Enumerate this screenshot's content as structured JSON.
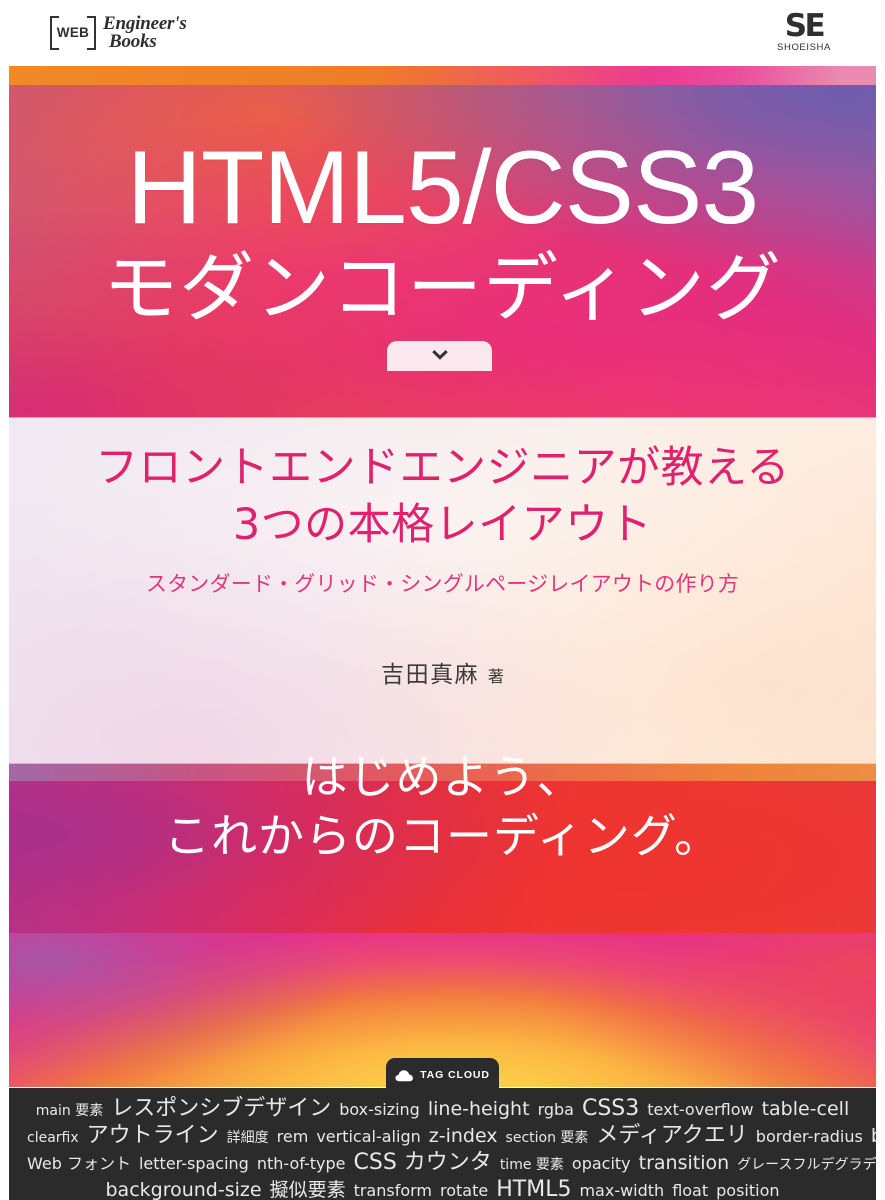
{
  "header": {
    "imprint": {
      "web_label": "WEB",
      "line1": "Engineer's",
      "line2": "Books"
    },
    "publisher": {
      "mark": "SE",
      "name": "SHOEISHA"
    }
  },
  "cover": {
    "title_main": "HTML5/CSS3",
    "title_sub": "モダンコーディング",
    "lead_line1": "フロントエンドエンジニアが教える",
    "lead_line2": "3つの本格レイアウト",
    "tagline": "スタンダード・グリッド・シングルページレイアウトの作り方",
    "author_name": "吉田真麻",
    "author_credit": "著",
    "slogan_line1": "はじめよう、",
    "slogan_line2": "これからのコーディング。",
    "chevron_icon": "chevron-down-icon"
  },
  "tag_cloud": {
    "badge_label": "TAG CLOUD",
    "badge_icon": "cloud-icon",
    "rows": [
      [
        {
          "text": "main 要素",
          "size": "s2"
        },
        {
          "text": "レスポンシブデザイン",
          "size": "s5"
        },
        {
          "text": "box-sizing",
          "size": "s3"
        },
        {
          "text": "line-height",
          "size": "s4"
        },
        {
          "text": "rgba",
          "size": "s3"
        },
        {
          "text": "CSS3",
          "size": "s5"
        },
        {
          "text": "text-overflow",
          "size": "s3"
        },
        {
          "text": "table-cell",
          "size": "s4"
        }
      ],
      [
        {
          "text": "clearfix",
          "size": "s2"
        },
        {
          "text": "アウトライン",
          "size": "s5"
        },
        {
          "text": "詳細度",
          "size": "s2"
        },
        {
          "text": "rem",
          "size": "s3"
        },
        {
          "text": "vertical-align",
          "size": "s3"
        },
        {
          "text": "z-index",
          "size": "s4"
        },
        {
          "text": "section 要素",
          "size": "s2"
        },
        {
          "text": "メディアクエリ",
          "size": "s5"
        },
        {
          "text": "border-radius",
          "size": "s3"
        },
        {
          "text": "box-shadow",
          "size": "s4"
        }
      ],
      [
        {
          "text": "Web フォント",
          "size": "s3"
        },
        {
          "text": "letter-spacing",
          "size": "s3"
        },
        {
          "text": "nth-of-type",
          "size": "s3"
        },
        {
          "text": "CSS カウンタ",
          "size": "s5"
        },
        {
          "text": "time 要素",
          "size": "s2"
        },
        {
          "text": "opacity",
          "size": "s3"
        },
        {
          "text": "transition",
          "size": "s4"
        },
        {
          "text": "グレースフルデグラデーション",
          "size": "s2"
        }
      ],
      [
        {
          "text": "background-size",
          "size": "s4"
        },
        {
          "text": "擬似要素",
          "size": "s4"
        },
        {
          "text": "transform",
          "size": "s3"
        },
        {
          "text": "rotate",
          "size": "s3"
        },
        {
          "text": "HTML5",
          "size": "s5"
        },
        {
          "text": "max-width",
          "size": "s3"
        },
        {
          "text": "float",
          "size": "s3"
        },
        {
          "text": "position",
          "size": "s3"
        }
      ]
    ]
  },
  "colors": {
    "accent_pink": "#e0216e",
    "accent_magenta": "#e3357d",
    "red_band": "#ec3934",
    "tagcloud_bg": "#2b2b2b",
    "gold": "#ffd04a",
    "purple": "#7d63ab"
  }
}
